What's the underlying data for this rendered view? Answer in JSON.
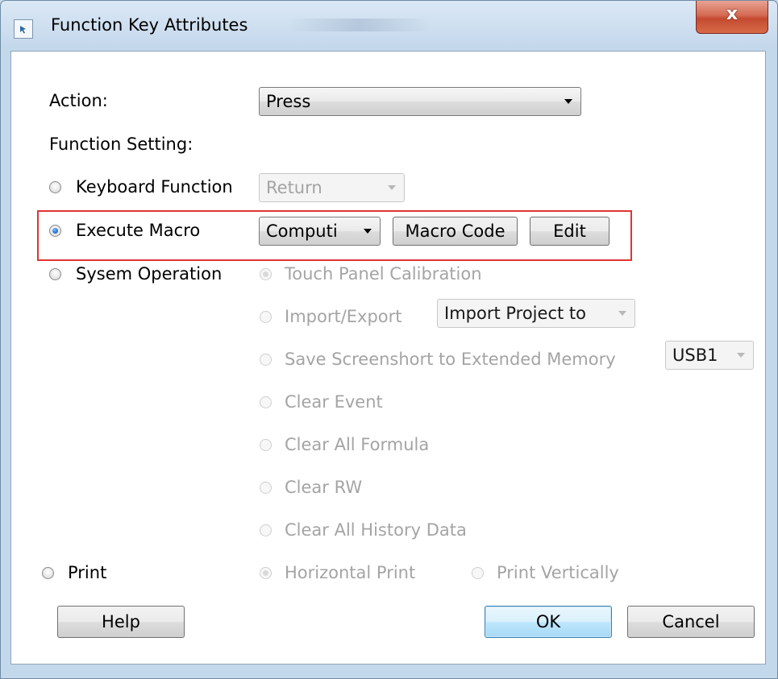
{
  "window": {
    "title": "Function Key Attributes",
    "close_label": "x"
  },
  "action": {
    "label": "Action:",
    "value": "Press"
  },
  "function_setting": {
    "label": "Function Setting:"
  },
  "keyboard_function": {
    "label": "Keyboard Function",
    "value": "Return"
  },
  "execute_macro": {
    "label": "Execute Macro",
    "macro_value": "Computi",
    "macro_code_label": "Macro Code",
    "edit_label": "Edit"
  },
  "system_operation": {
    "label": "Sysem Operation",
    "touch_panel": "Touch Panel Calibration",
    "import_export": "Import/Export",
    "import_value": "Import Project to",
    "save_screenshot": "Save Screenshort to Extended Memory",
    "usb_value": "USB1",
    "clear_event": "Clear Event",
    "clear_all_formula": "Clear All Formula",
    "clear_rw": "Clear RW",
    "clear_history": "Clear All History Data"
  },
  "print": {
    "label": "Print",
    "horizontal": "Horizontal Print",
    "vertical": "Print Vertically"
  },
  "buttons": {
    "help": "Help",
    "ok": "OK",
    "cancel": "Cancel"
  },
  "colors": {
    "highlight_border": "#e03434",
    "title_bar": "#c4d8ec",
    "radio_selected": "#1f6fd8"
  }
}
